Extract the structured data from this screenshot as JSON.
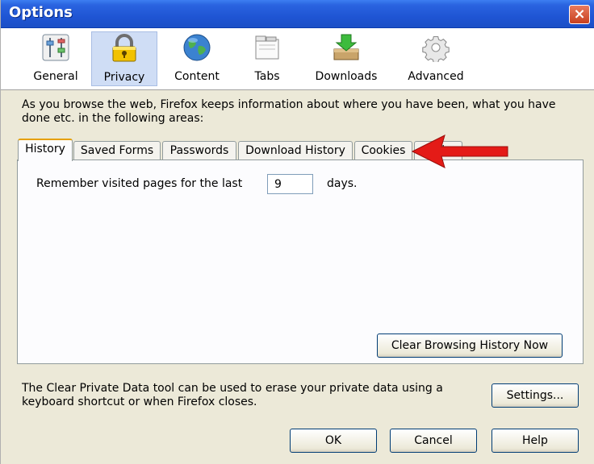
{
  "window": {
    "title": "Options",
    "close_glyph": "×"
  },
  "toolbar": {
    "panes": [
      {
        "label": "General",
        "icon": "sliders-icon",
        "selected": false
      },
      {
        "label": "Privacy",
        "icon": "padlock-icon",
        "selected": true
      },
      {
        "label": "Content",
        "icon": "globe-icon",
        "selected": false
      },
      {
        "label": "Tabs",
        "icon": "tabs-icon",
        "selected": false
      },
      {
        "label": "Downloads",
        "icon": "downloads-icon",
        "selected": false
      },
      {
        "label": "Advanced",
        "icon": "gear-icon",
        "selected": false
      }
    ]
  },
  "privacy": {
    "description": "As you browse the web, Firefox keeps information about where you have been, what you have done etc. in the following areas:",
    "tabs": [
      {
        "label": "History",
        "active": true
      },
      {
        "label": "Saved Forms",
        "active": false
      },
      {
        "label": "Passwords",
        "active": false
      },
      {
        "label": "Download History",
        "active": false
      },
      {
        "label": "Cookies",
        "active": false
      },
      {
        "label": "Cache",
        "active": false
      }
    ],
    "history": {
      "label": "Remember visited pages for the last",
      "days_value": "9",
      "days_unit": "days.",
      "clear_button": "Clear Browsing History Now"
    },
    "footer_text": "The Clear Private Data tool can be used to erase your private data using a keyboard shortcut or when Firefox closes.",
    "settings_button": "Settings..."
  },
  "buttons": {
    "ok": "OK",
    "cancel": "Cancel",
    "help": "Help"
  },
  "colors": {
    "titlebar": "#1f55d4",
    "selected_pane": "#cfddf5",
    "arrow": "#e41b17",
    "active_tab_accent": "#e6a000"
  }
}
